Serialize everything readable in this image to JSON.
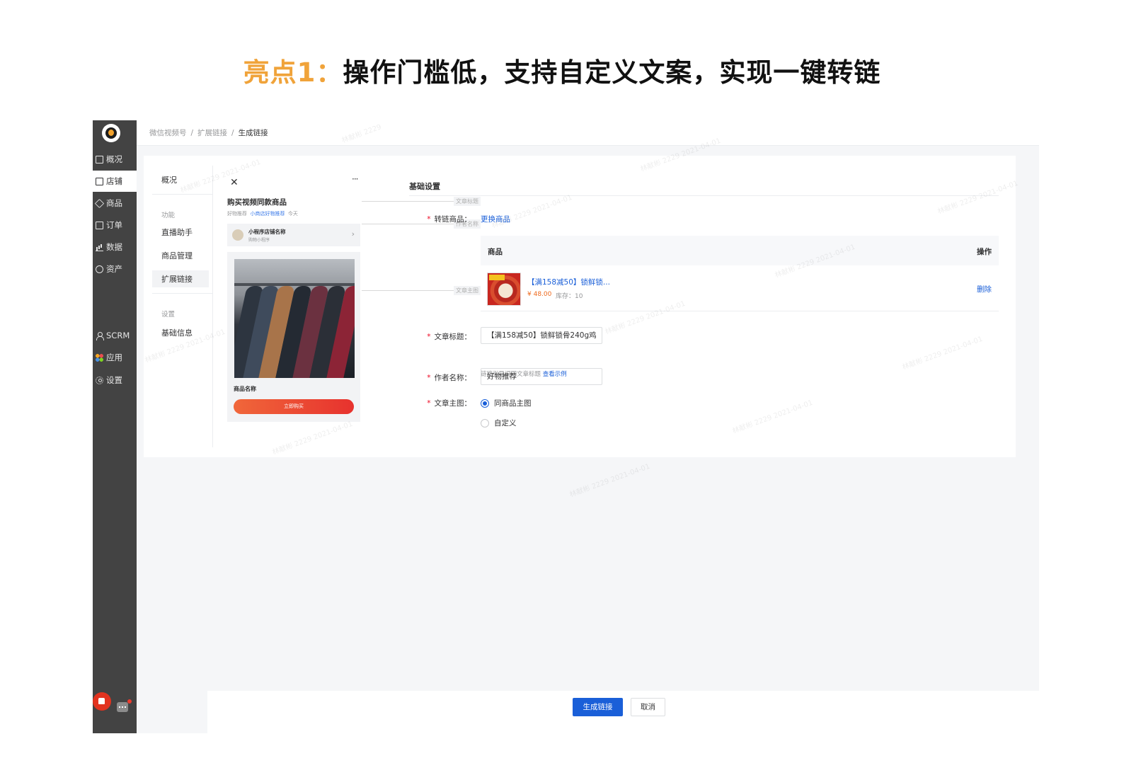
{
  "headline": {
    "accent": "亮点1：",
    "main": "操作门槛低，支持自定义文案，实现一键转链"
  },
  "sidebar": {
    "items": [
      {
        "label": "概况",
        "icon": "monitor-icon"
      },
      {
        "label": "店铺",
        "icon": "store-icon",
        "active": true
      },
      {
        "label": "商品",
        "icon": "tag-icon"
      },
      {
        "label": "订单",
        "icon": "order-icon"
      },
      {
        "label": "数据",
        "icon": "chart-icon"
      },
      {
        "label": "资产",
        "icon": "yuan-icon"
      },
      {
        "label": "SCRM",
        "icon": "person-icon"
      },
      {
        "label": "应用",
        "icon": "apps-icon"
      },
      {
        "label": "设置",
        "icon": "gear-icon"
      }
    ]
  },
  "breadcrumb": {
    "item1": "微信视频号",
    "item2": "扩展链接",
    "current": "生成链接",
    "separator": "/"
  },
  "subnav": {
    "overview": "概况",
    "group_function": "功能",
    "live": "直播助手",
    "goods": "商品管理",
    "extend": "扩展链接",
    "group_settings": "设置",
    "basic": "基础信息"
  },
  "preview": {
    "close": "✕",
    "more": "···",
    "title": "购买视频同款商品",
    "meta_author": "好物推荐",
    "meta_shop": "小商店好物推荐",
    "meta_time": "今天",
    "store_name": "小程序店铺名称",
    "store_sub": "购物小程序",
    "goods_name": "商品名称",
    "buy_button": "立即购买",
    "labels": {
      "title": "文章标题",
      "author": "作者名称",
      "image": "文章主图"
    }
  },
  "form": {
    "section_title": "基础设置",
    "product_label": "转链商品：",
    "change_product": "更换商品",
    "table": {
      "col_goods": "商品",
      "col_action": "操作",
      "rows": [
        {
          "name": "【满158减50】锁鲜锁...",
          "price": "¥ 48.00",
          "stock": "库存：10",
          "action": "删除"
        }
      ]
    },
    "title_label": "文章标题：",
    "title_value": "【满158减50】锁鲜锁骨240g鸡",
    "title_help": "链接引导词同文章标题",
    "title_example": "查看示例",
    "author_label": "作者名称：",
    "author_value": "好物推荐",
    "image_label": "文章主图：",
    "image_option1": "同商品主图",
    "image_option2": "自定义",
    "image_selected": "同商品主图"
  },
  "footer": {
    "submit": "生成链接",
    "cancel": "取消"
  },
  "colors": {
    "accent": "#f0a33a",
    "primary": "#1a5fd8",
    "sidebar": "#434343",
    "danger": "#ee0a24",
    "price": "#ee6a1e"
  }
}
